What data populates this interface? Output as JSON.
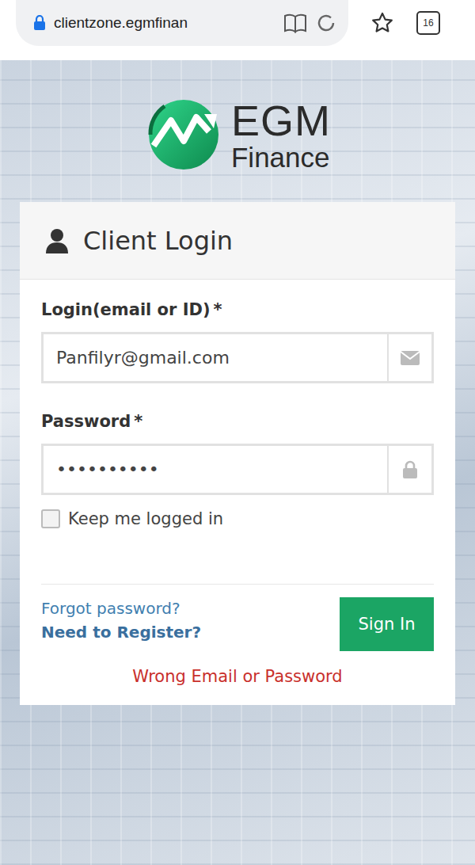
{
  "browser": {
    "url": "clientzone.egmfinan",
    "tab_count": "16"
  },
  "logo": {
    "name": "EGM",
    "subtitle": "Finance"
  },
  "login": {
    "title": "Client Login",
    "email_label": "Login(email or ID)",
    "email_required": "*",
    "email_value": "Panfilyr@gmail.com",
    "password_label": "Password",
    "password_required": "*",
    "password_mask": "••••••••••",
    "keep_logged_in": {
      "label": "Keep me logged in",
      "checked": false
    },
    "forgot_link": "Forgot password?",
    "register_link": "Need to Register?",
    "submit": "Sign In",
    "error": "Wrong Email or Password"
  }
}
